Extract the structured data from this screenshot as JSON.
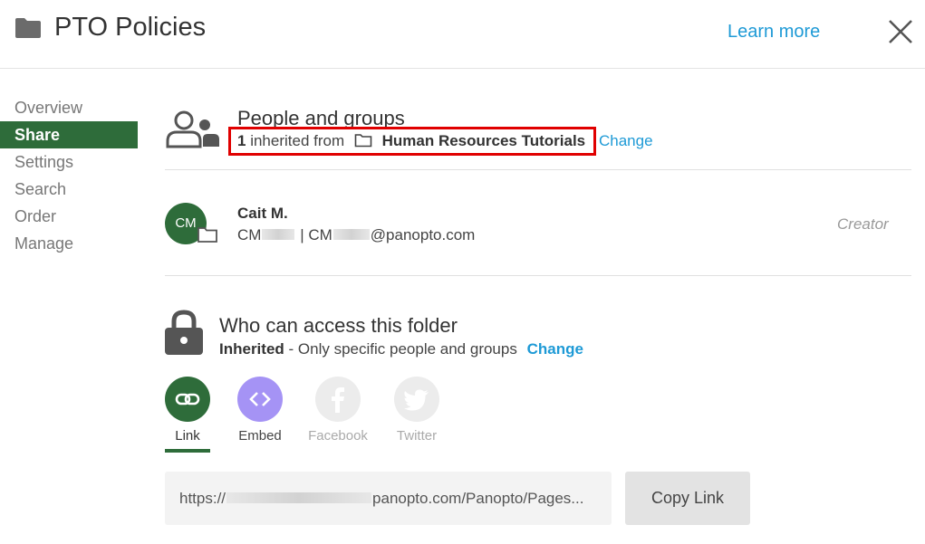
{
  "header": {
    "title": "PTO Policies",
    "learn_more": "Learn more"
  },
  "sidebar": {
    "items": [
      {
        "label": "Overview"
      },
      {
        "label": "Share"
      },
      {
        "label": "Settings"
      },
      {
        "label": "Search"
      },
      {
        "label": "Order"
      },
      {
        "label": "Manage"
      }
    ],
    "active": "Share"
  },
  "people": {
    "title": "People and groups",
    "count": "1",
    "inherited_text": "inherited from",
    "folder_name": "Human Resources Tutorials",
    "change": "Change"
  },
  "user": {
    "initials": "CM",
    "name": "Cait M.",
    "email_prefix": "CM",
    "separator": "|",
    "email_prefix2": "CM",
    "email_domain": "@panopto.com",
    "role": "Creator"
  },
  "access": {
    "title": "Who can access this folder",
    "level": "Inherited",
    "description": "- Only specific people and groups",
    "change": "Change"
  },
  "share_options": {
    "link": "Link",
    "embed": "Embed",
    "facebook": "Facebook",
    "twitter": "Twitter"
  },
  "url_box": {
    "prefix": "https://",
    "suffix": "panopto.com/Panopto/Pages..."
  },
  "copy_link": "Copy Link",
  "colors": {
    "accent_green": "#2e6c3a",
    "link_blue": "#1e9ad6",
    "embed_purple": "#a593f5",
    "highlight_red": "#e00000"
  }
}
